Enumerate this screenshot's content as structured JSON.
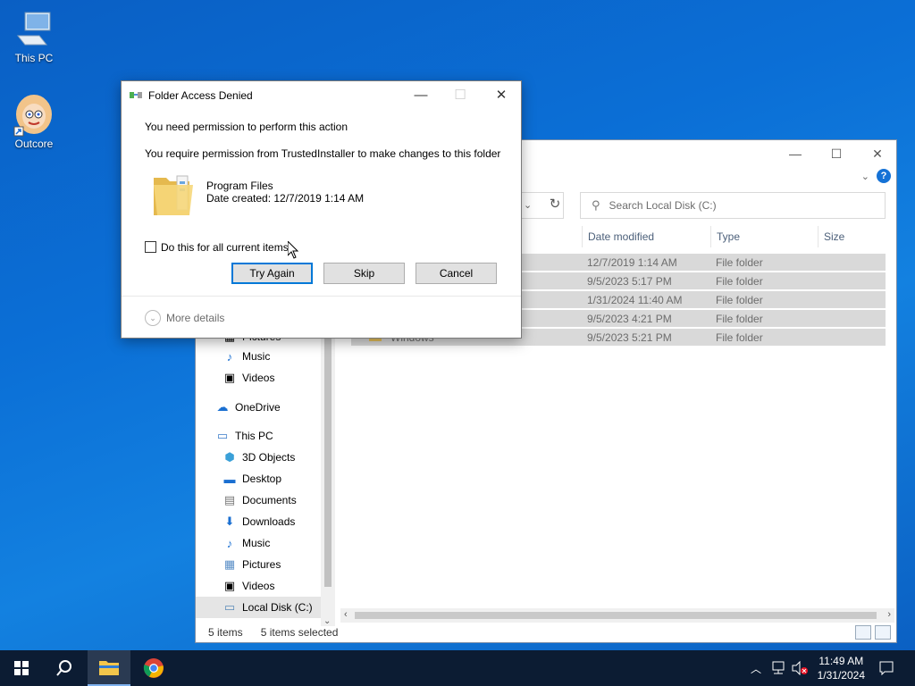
{
  "desktop": {
    "icons": [
      {
        "label": "This PC",
        "icon": "computer-icon"
      },
      {
        "label": "Outcore",
        "icon": "outcore-app-icon"
      }
    ]
  },
  "explorer": {
    "search_placeholder": "Search Local Disk (C:)",
    "columns": [
      "Date modified",
      "Type",
      "Size"
    ],
    "rows": [
      {
        "name": "",
        "date": "12/7/2019 1:14 AM",
        "type": "File folder"
      },
      {
        "name": "",
        "date": "9/5/2023 5:17 PM",
        "type": "File folder"
      },
      {
        "name": "",
        "date": "1/31/2024 11:40 AM",
        "type": "File folder"
      },
      {
        "name": "",
        "date": "9/5/2023 4:21 PM",
        "type": "File folder"
      },
      {
        "name": "Windows",
        "date": "9/5/2023 5:21 PM",
        "type": "File folder"
      }
    ],
    "nav": [
      {
        "label": "Pictures",
        "icon": "pictures-icon"
      },
      {
        "label": "Music",
        "icon": "music-icon"
      },
      {
        "label": "Videos",
        "icon": "videos-icon"
      },
      {
        "label": "OneDrive",
        "icon": "onedrive-icon"
      },
      {
        "label": "This PC",
        "icon": "computer-icon"
      },
      {
        "label": "3D Objects",
        "icon": "3d-objects-icon"
      },
      {
        "label": "Desktop",
        "icon": "desktop-icon"
      },
      {
        "label": "Documents",
        "icon": "documents-icon"
      },
      {
        "label": "Downloads",
        "icon": "downloads-icon"
      },
      {
        "label": "Music",
        "icon": "music-icon"
      },
      {
        "label": "Pictures",
        "icon": "pictures-icon"
      },
      {
        "label": "Videos",
        "icon": "videos-icon"
      },
      {
        "label": "Local Disk (C:)",
        "icon": "drive-icon"
      }
    ],
    "status": {
      "items": "5 items",
      "selected": "5 items selected"
    }
  },
  "dialog": {
    "title": "Folder Access Denied",
    "heading": "You need permission to perform this action",
    "message": "You require permission from TrustedInstaller to make changes to this folder",
    "folder_name": "Program Files",
    "date_created": "Date created: 12/7/2019 1:14 AM",
    "checkbox_label": "Do this for all current items",
    "checkbox_checked": false,
    "buttons": {
      "try_again": "Try Again",
      "skip": "Skip",
      "cancel": "Cancel"
    },
    "more_details": "More details"
  },
  "taskbar": {
    "time": "11:49 AM",
    "date": "1/31/2024",
    "pinned": [
      "start-icon",
      "search-icon",
      "file-explorer-icon",
      "chrome-icon"
    ]
  },
  "colors": {
    "accent": "#0078d7",
    "taskbar": "#0c1c33",
    "selection": "#d9d9d9"
  }
}
